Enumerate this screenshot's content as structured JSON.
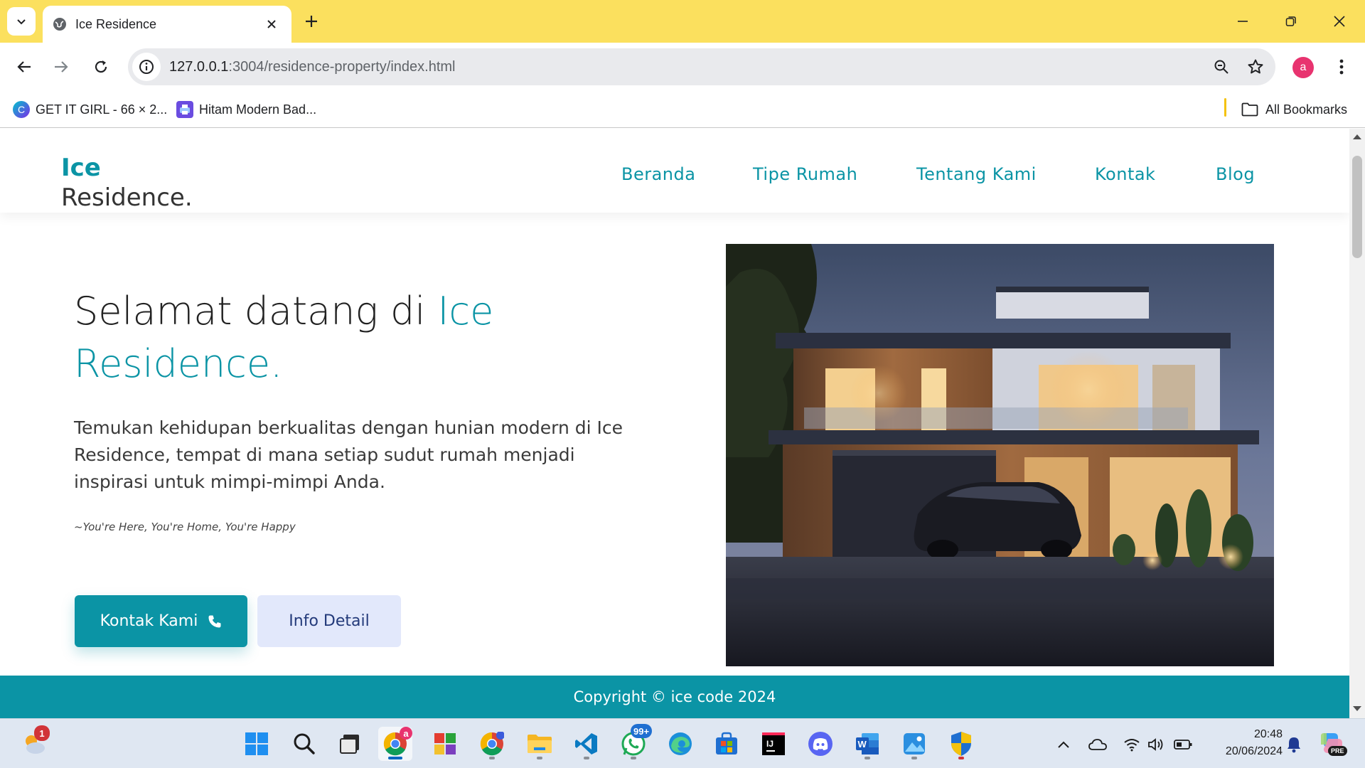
{
  "browser": {
    "tab_title": "Ice Residence",
    "url_host": "127.0.0.1",
    "url_path": ":3004/residence-property/index.html",
    "profile_initial": "a",
    "bookmarks": [
      {
        "label": "GET IT GIRL - 66 × 2..."
      },
      {
        "label": "Hitam Modern Bad..."
      }
    ],
    "all_bookmarks_label": "All Bookmarks"
  },
  "site": {
    "logo_line1": "Ice",
    "logo_line2": "Residence.",
    "nav": [
      "Beranda",
      "Tipe Rumah",
      "Tentang Kami",
      "Kontak",
      "Blog"
    ],
    "hero": {
      "title_plain": "Selamat datang di ",
      "title_accent": "Ice Residence.",
      "description": "Temukan kehidupan berkualitas dengan hunian modern di Ice Residence, tempat di mana setiap sudut rumah menjadi inspirasi untuk mimpi-mimpi Anda.",
      "tagline": "~You're Here, You're Home, You're Happy",
      "primary_button": "Kontak Kami",
      "secondary_button": "Info Detail"
    },
    "footer": "Copyright © ice code 2024"
  },
  "colors": {
    "accent": "#0b94a5",
    "tab_strip": "#fbe05e",
    "secondary_button_bg": "#e2e8fb"
  },
  "taskbar": {
    "weather_badge": "1",
    "chrome_badge": "a",
    "whatsapp_badge": "99+",
    "time": "20:48",
    "date": "20/06/2024",
    "copilot_label": "PRE"
  }
}
